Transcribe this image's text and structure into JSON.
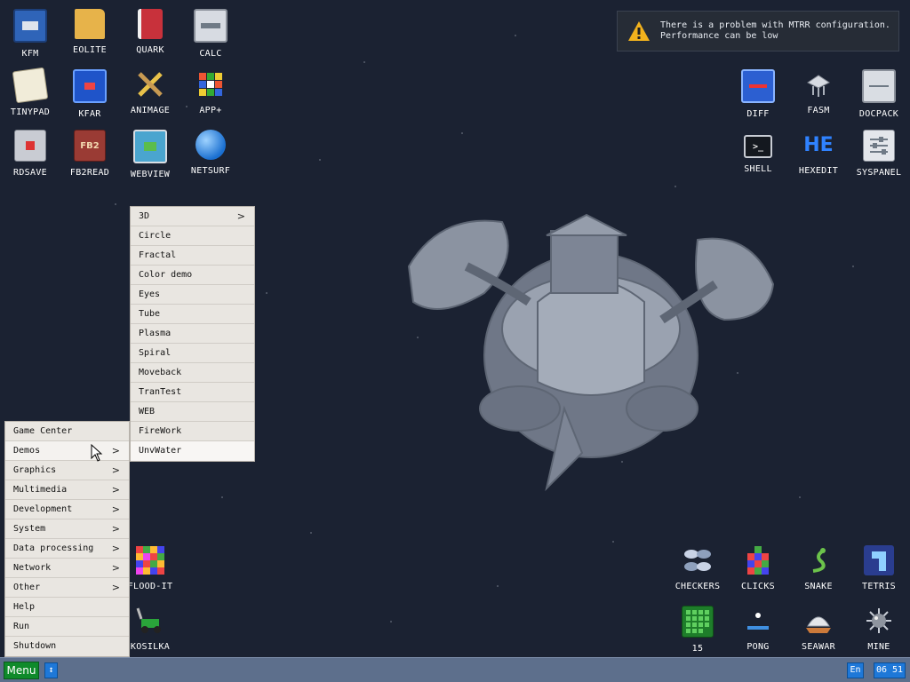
{
  "desktop": {
    "icons_top_left": [
      {
        "label": "KFM",
        "icon": "floppy-disk-icon"
      },
      {
        "label": "EOLITE",
        "icon": "folder-icon"
      },
      {
        "label": "QUARK",
        "icon": "notebook-icon"
      },
      {
        "label": "CALC",
        "icon": "calculator-icon"
      },
      {
        "label": "TINYPAD",
        "icon": "notepad-icon"
      },
      {
        "label": "KFAR",
        "icon": "dual-panel-icon"
      },
      {
        "label": "ANIMAGE",
        "icon": "pencil-ruler-icon"
      },
      {
        "label": "APP+",
        "icon": "rubik-cube-icon"
      },
      {
        "label": "RDSAVE",
        "icon": "ramdisk-save-icon"
      },
      {
        "label": "FB2READ",
        "icon": "book-icon"
      },
      {
        "label": "WEBVIEW",
        "icon": "web-image-icon"
      },
      {
        "label": "NETSURF",
        "icon": "globe-icon"
      }
    ],
    "icons_top_right": [
      {
        "label": "DIFF",
        "icon": "diff-icon"
      },
      {
        "label": "FASM",
        "icon": "assembler-icon"
      },
      {
        "label": "DOCPACK",
        "icon": "docpack-icon"
      },
      {
        "label": "SHELL",
        "icon": "terminal-icon"
      },
      {
        "label": "HEXEDIT",
        "icon": "hex-editor-icon"
      },
      {
        "label": "SYSPANEL",
        "icon": "sliders-icon"
      }
    ],
    "icons_bottom_left": [
      {
        "label": "FLOOD-IT",
        "icon": "color-grid-icon"
      },
      {
        "label": "KOSILKA",
        "icon": "lawnmower-icon"
      }
    ],
    "icons_bottom_right": [
      {
        "label": "CHECKERS",
        "icon": "checkers-icon"
      },
      {
        "label": "CLICKS",
        "icon": "blocks-icon"
      },
      {
        "label": "SNAKE",
        "icon": "snake-icon"
      },
      {
        "label": "TETRIS",
        "icon": "tetris-icon"
      },
      {
        "label": "15",
        "icon": "fifteen-puzzle-icon"
      },
      {
        "label": "PONG",
        "icon": "pong-icon"
      },
      {
        "label": "SEAWAR",
        "icon": "seawar-icon"
      },
      {
        "label": "MINE",
        "icon": "mine-icon"
      }
    ]
  },
  "notification": {
    "line1": "There is a problem with MTRR configuration.",
    "line2": "Performance can be low"
  },
  "main_menu": {
    "items": [
      {
        "label": "Game Center",
        "arrow": ""
      },
      {
        "label": "Demos",
        "arrow": ">"
      },
      {
        "label": "Graphics",
        "arrow": ">"
      },
      {
        "label": "Multimedia",
        "arrow": ">"
      },
      {
        "label": "Development",
        "arrow": ">"
      },
      {
        "label": "System",
        "arrow": ">"
      },
      {
        "label": "Data processing",
        "arrow": ">"
      },
      {
        "label": "Network",
        "arrow": ">"
      },
      {
        "label": "Other",
        "arrow": ">"
      },
      {
        "label": "Help",
        "arrow": ""
      },
      {
        "label": "Run",
        "arrow": ""
      },
      {
        "label": "Shutdown",
        "arrow": ""
      }
    ]
  },
  "demos_menu": {
    "items": [
      {
        "label": "3D",
        "arrow": ">"
      },
      {
        "label": "Circle",
        "arrow": ""
      },
      {
        "label": "Fractal",
        "arrow": ""
      },
      {
        "label": "Color demo",
        "arrow": ""
      },
      {
        "label": "Eyes",
        "arrow": ""
      },
      {
        "label": "Tube",
        "arrow": ""
      },
      {
        "label": "Plasma",
        "arrow": ""
      },
      {
        "label": "Spiral",
        "arrow": ""
      },
      {
        "label": "Moveback",
        "arrow": ""
      },
      {
        "label": "TranTest",
        "arrow": ""
      },
      {
        "label": "WEB",
        "arrow": ""
      },
      {
        "label": "FireWork",
        "arrow": ""
      },
      {
        "label": "UnvWater",
        "arrow": ""
      }
    ]
  },
  "taskbar": {
    "menu_label": "Menu",
    "toggle_label": "↕",
    "lang": "En",
    "clock": "06 51"
  }
}
